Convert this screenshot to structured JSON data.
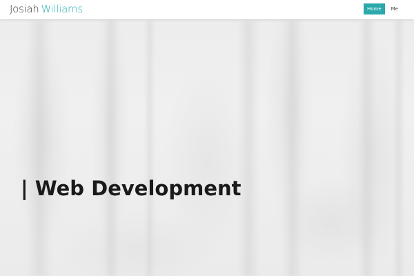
{
  "header": {
    "brand_first": "Josiah",
    "brand_last": "Williams"
  },
  "nav": {
    "items": [
      {
        "label": "Home",
        "active": true
      },
      {
        "label": "Me",
        "active": false
      }
    ]
  },
  "hero": {
    "headline": "| Web Development"
  },
  "colors": {
    "accent": "#2aa8ab",
    "brand_secondary": "#2ab0b4",
    "text_dark": "#1a1a1a",
    "background": "#f0f0f0"
  }
}
